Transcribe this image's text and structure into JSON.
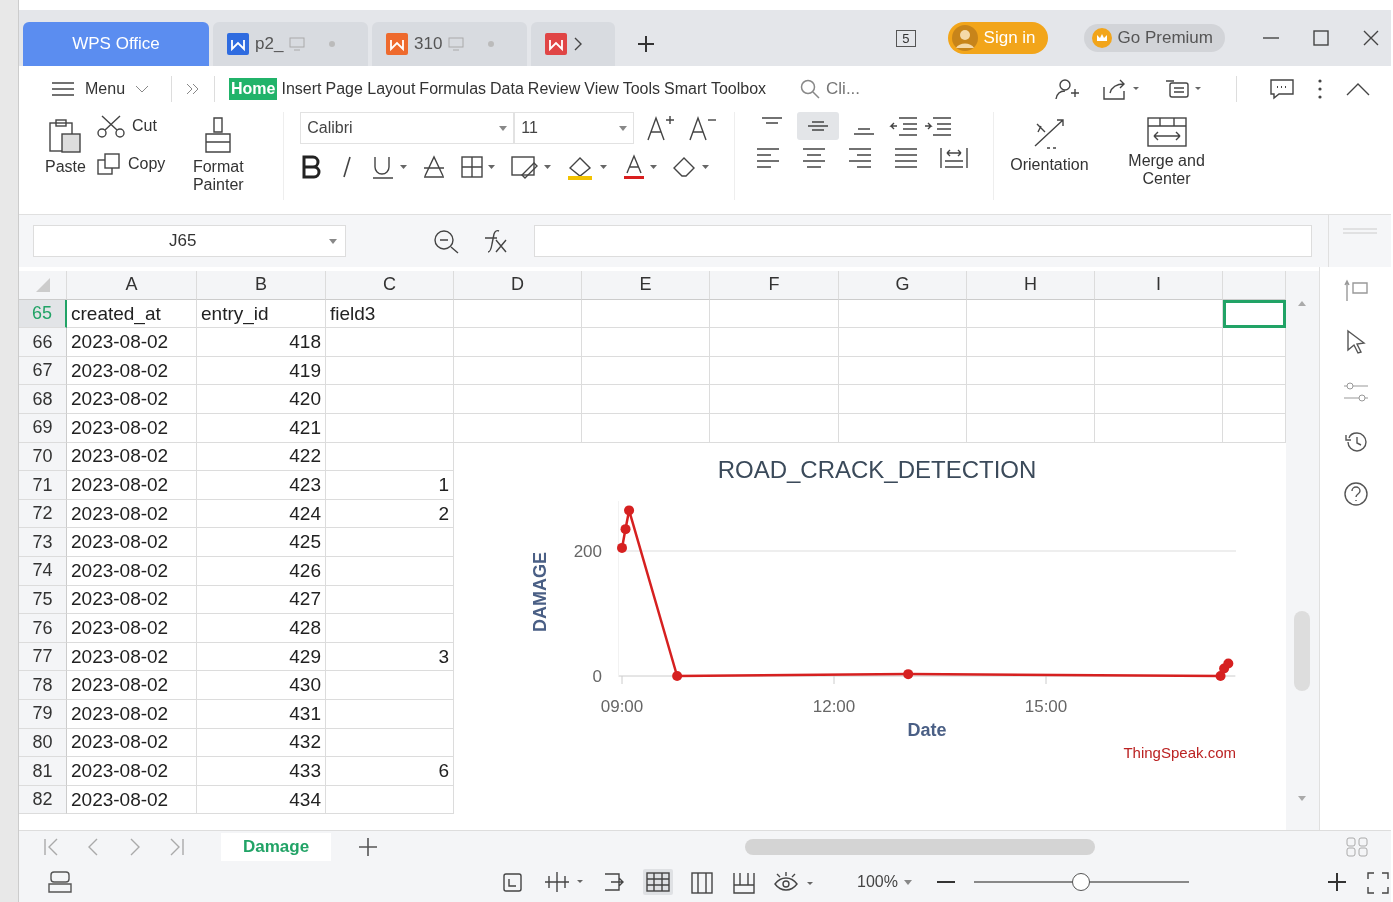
{
  "title_bar": {
    "tabs": [
      {
        "label": "WPS Office",
        "kind": "home",
        "selected": true
      },
      {
        "label": "p2_",
        "kind": "writer",
        "selected": false
      },
      {
        "label": "310",
        "kind": "presentation",
        "selected": false
      },
      {
        "kind": "pdf",
        "selected": false
      }
    ],
    "page_count": "5",
    "sign_in": "Sign in",
    "premium": "Go Premium"
  },
  "menu_bar": {
    "menu": "Menu",
    "tabs": [
      {
        "label": "Home",
        "selected": true
      },
      {
        "label": "Insert",
        "selected": false
      },
      {
        "label": "Page Layout",
        "selected": false
      },
      {
        "label": "Formulas",
        "selected": false
      },
      {
        "label": "Data",
        "selected": false
      },
      {
        "label": "Review",
        "selected": false
      },
      {
        "label": "View",
        "selected": false
      },
      {
        "label": "Tools",
        "selected": false
      },
      {
        "label": "Smart Toolbox",
        "selected": false
      }
    ],
    "search": {
      "placeholder": "Cli..."
    }
  },
  "ribbon": {
    "paste": "Paste",
    "cut": "Cut",
    "copy": "Copy",
    "format_painter": "Format Painter",
    "font": "Calibri",
    "font_size": "11",
    "vertical_align": [
      {
        "selected": false
      },
      {
        "selected": true
      },
      {
        "selected": false
      }
    ],
    "orientation": "Orientation",
    "merge": "Merge and Center"
  },
  "formula_bar": {
    "cell_ref": "J65"
  },
  "sheet": {
    "columns": [
      "A",
      "B",
      "C",
      "D",
      "E",
      "F",
      "G",
      "H",
      "I"
    ],
    "rows": [
      {
        "number": "65",
        "active": true,
        "cells": [
          "created_at",
          "entry_id",
          "field3"
        ]
      },
      {
        "number": "66",
        "active": false,
        "cells": [
          "2023-08-02",
          "418",
          ""
        ]
      },
      {
        "number": "67",
        "active": false,
        "cells": [
          "2023-08-02",
          "419",
          ""
        ]
      },
      {
        "number": "68",
        "active": false,
        "cells": [
          "2023-08-02",
          "420",
          ""
        ]
      },
      {
        "number": "69",
        "active": false,
        "cells": [
          "2023-08-02",
          "421",
          ""
        ]
      },
      {
        "number": "70",
        "active": false,
        "cells": [
          "2023-08-02",
          "422",
          ""
        ]
      },
      {
        "number": "71",
        "active": false,
        "cells": [
          "2023-08-02",
          "423",
          "1"
        ]
      },
      {
        "number": "72",
        "active": false,
        "cells": [
          "2023-08-02",
          "424",
          "2"
        ]
      },
      {
        "number": "73",
        "active": false,
        "cells": [
          "2023-08-02",
          "425",
          ""
        ]
      },
      {
        "number": "74",
        "active": false,
        "cells": [
          "2023-08-02",
          "426",
          ""
        ]
      },
      {
        "number": "75",
        "active": false,
        "cells": [
          "2023-08-02",
          "427",
          ""
        ]
      },
      {
        "number": "76",
        "active": false,
        "cells": [
          "2023-08-02",
          "428",
          ""
        ]
      },
      {
        "number": "77",
        "active": false,
        "cells": [
          "2023-08-02",
          "429",
          "3"
        ]
      },
      {
        "number": "78",
        "active": false,
        "cells": [
          "2023-08-02",
          "430",
          ""
        ]
      },
      {
        "number": "79",
        "active": false,
        "cells": [
          "2023-08-02",
          "431",
          ""
        ]
      },
      {
        "number": "80",
        "active": false,
        "cells": [
          "2023-08-02",
          "432",
          ""
        ]
      },
      {
        "number": "81",
        "active": false,
        "cells": [
          "2023-08-02",
          "433",
          "6"
        ]
      },
      {
        "number": "82",
        "active": false,
        "cells": [
          "2023-08-02",
          "434",
          ""
        ]
      }
    ],
    "chart": {
      "credit": "ThingSpeak.com",
      "chart_data": {
        "type": "line",
        "title": "ROAD_CRACK_DETECTION",
        "xlabel": "Date",
        "ylabel": "DAMAGE",
        "x": [
          9.0,
          9.05,
          9.1,
          9.78,
          13.05,
          17.47,
          17.52,
          17.58
        ],
        "series": [
          {
            "color": "#d62020",
            "marker": "circle",
            "values": [
              205,
              235,
              265,
              0,
              3,
              0,
              12,
              20
            ]
          }
        ],
        "xlim": [
          8.95,
          17.68
        ],
        "ylim": [
          0,
          280
        ],
        "xticks": [
          {
            "value": 9,
            "label": "09:00"
          },
          {
            "value": 12,
            "label": "12:00"
          },
          {
            "value": 15,
            "label": "15:00"
          }
        ],
        "yticks": [
          0,
          200
        ]
      }
    }
  },
  "sheet_tabs": [
    {
      "label": "Damage",
      "selected": true
    }
  ],
  "status_bar": {
    "zoom": "100%",
    "zoom_slider": {
      "level": 0.5
    }
  }
}
